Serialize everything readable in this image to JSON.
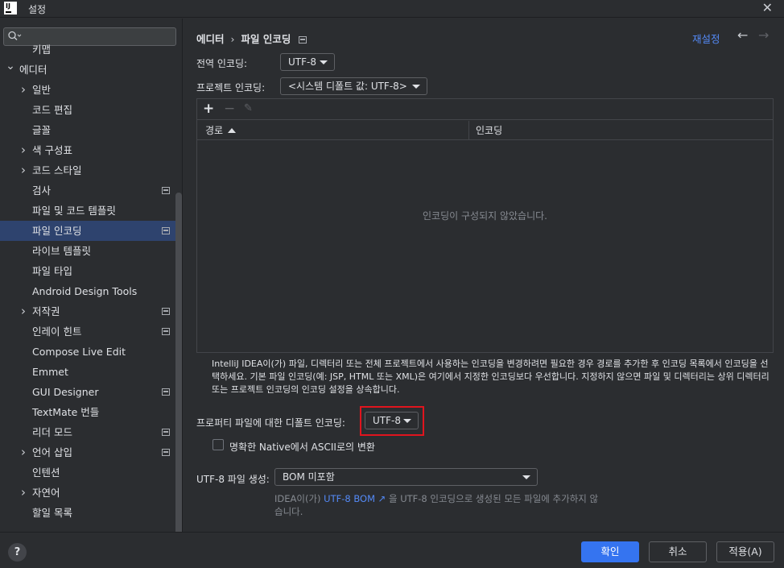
{
  "window": {
    "title": "설정",
    "app_icon": "IJ"
  },
  "sidebar": {
    "search_placeholder": "",
    "items": [
      {
        "label": "키맵",
        "indent": 1,
        "chevron": "",
        "project": false,
        "selected": false
      },
      {
        "label": "에디터",
        "indent": 0,
        "chevron": "expanded",
        "project": false,
        "selected": false
      },
      {
        "label": "일반",
        "indent": 1,
        "chevron": "collapsed",
        "project": false,
        "selected": false
      },
      {
        "label": "코드 편집",
        "indent": 2,
        "chevron": "",
        "project": false,
        "selected": false
      },
      {
        "label": "글꼴",
        "indent": 2,
        "chevron": "",
        "project": false,
        "selected": false
      },
      {
        "label": "색 구성표",
        "indent": 1,
        "chevron": "collapsed",
        "project": false,
        "selected": false
      },
      {
        "label": "코드 스타일",
        "indent": 1,
        "chevron": "collapsed",
        "project": false,
        "selected": false
      },
      {
        "label": "검사",
        "indent": 2,
        "chevron": "",
        "project": true,
        "selected": false
      },
      {
        "label": "파일 및 코드 템플릿",
        "indent": 2,
        "chevron": "",
        "project": false,
        "selected": false
      },
      {
        "label": "파일 인코딩",
        "indent": 2,
        "chevron": "",
        "project": true,
        "selected": true
      },
      {
        "label": "라이브 템플릿",
        "indent": 2,
        "chevron": "",
        "project": false,
        "selected": false
      },
      {
        "label": "파일 타입",
        "indent": 2,
        "chevron": "",
        "project": false,
        "selected": false
      },
      {
        "label": "Android Design Tools",
        "indent": 2,
        "chevron": "",
        "project": false,
        "selected": false
      },
      {
        "label": "저작권",
        "indent": 1,
        "chevron": "collapsed",
        "project": true,
        "selected": false
      },
      {
        "label": "인레이 힌트",
        "indent": 2,
        "chevron": "",
        "project": true,
        "selected": false
      },
      {
        "label": "Compose Live Edit",
        "indent": 2,
        "chevron": "",
        "project": false,
        "selected": false
      },
      {
        "label": "Emmet",
        "indent": 2,
        "chevron": "",
        "project": false,
        "selected": false
      },
      {
        "label": "GUI Designer",
        "indent": 2,
        "chevron": "",
        "project": true,
        "selected": false
      },
      {
        "label": "TextMate 번들",
        "indent": 2,
        "chevron": "",
        "project": false,
        "selected": false
      },
      {
        "label": "리더 모드",
        "indent": 2,
        "chevron": "",
        "project": true,
        "selected": false
      },
      {
        "label": "언어 삽입",
        "indent": 1,
        "chevron": "collapsed",
        "project": true,
        "selected": false
      },
      {
        "label": "인텐션",
        "indent": 2,
        "chevron": "",
        "project": false,
        "selected": false
      },
      {
        "label": "자연어",
        "indent": 1,
        "chevron": "collapsed",
        "project": false,
        "selected": false
      },
      {
        "label": "할일 목록",
        "indent": 2,
        "chevron": "",
        "project": false,
        "selected": false
      }
    ]
  },
  "header": {
    "breadcrumb_parent": "에디터",
    "breadcrumb_sep": "›",
    "breadcrumb_current": "파일 인코딩",
    "reset": "재설정",
    "back": "←",
    "forward": "→"
  },
  "settings": {
    "global_label": "전역 인코딩:",
    "global_value": "UTF-8",
    "project_label": "프로젝트 인코딩:",
    "project_value": "<시스템 디폴트 값: UTF-8>",
    "properties_label": "프로퍼티 파일에 대한 디폴트 인코딩:",
    "properties_value": "UTF-8",
    "native_checkbox_label": "명확한 Native에서 ASCII로의 변환",
    "native_checked": false,
    "bom_label": "UTF-8 파일 생성:",
    "bom_value": "BOM 미포함"
  },
  "table": {
    "add": "+",
    "remove": "−",
    "edit": "✎",
    "columns": [
      "경로",
      "인코딩"
    ],
    "empty_text": "인코딩이 구성되지 않았습니다."
  },
  "description": "IntelliJ IDEA이(가) 파일, 디렉터리 또는 전체 프로젝트에서 사용하는 인코딩을 변경하려면 필요한 경우 경로를 추가한 후 인코딩 목록에서 인코딩을 선택하세요. 기본 파일 인코딩(예: JSP, HTML 또는 XML)은 여기에서 지정한 인코딩보다 우선합니다. 지정하지 않으면 파일 및 디렉터리는 상위 디렉터리 또는 프로젝트 인코딩의 인코딩 설정을 상속합니다.",
  "bom_note": {
    "prefix": "IDEA이(가) ",
    "link": "UTF-8 BOM ↗",
    "suffix": " 을 UTF-8 인코딩으로 생성된 모든 파일에 추가하지 않습니다."
  },
  "footer": {
    "help": "?",
    "ok": "확인",
    "cancel": "취소",
    "apply": "적용(A)"
  },
  "colors": {
    "accent": "#3574f0",
    "link": "#548af7",
    "selection": "#2e436e",
    "highlight_box": "#e0141e"
  }
}
